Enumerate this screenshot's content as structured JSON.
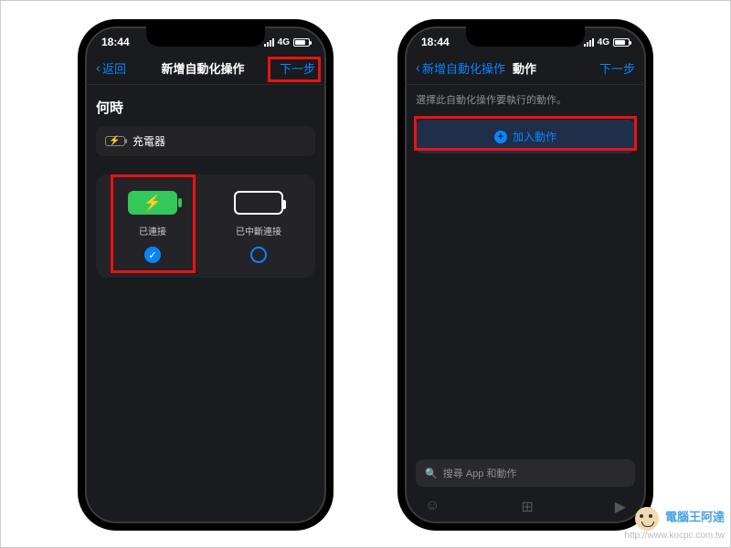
{
  "status": {
    "time": "18:44",
    "network": "4G"
  },
  "phone1": {
    "nav": {
      "back": "返回",
      "title": "新增自動化操作",
      "next": "下一步"
    },
    "when_heading": "何時",
    "trigger_label": "充電器",
    "options": {
      "connected": {
        "label": "已連接"
      },
      "disconnected": {
        "label": "已中斷連接"
      }
    }
  },
  "phone2": {
    "nav": {
      "back": "新增自動化操作",
      "title": "動作",
      "next": "下一步"
    },
    "instruction": "選擇此自動化操作要執行的動作。",
    "add_action": "加入動作",
    "search_placeholder": "搜尋 App 和動作"
  },
  "watermark": {
    "title": "電腦王阿達",
    "url": "http://www.kocpc.com.tw"
  }
}
